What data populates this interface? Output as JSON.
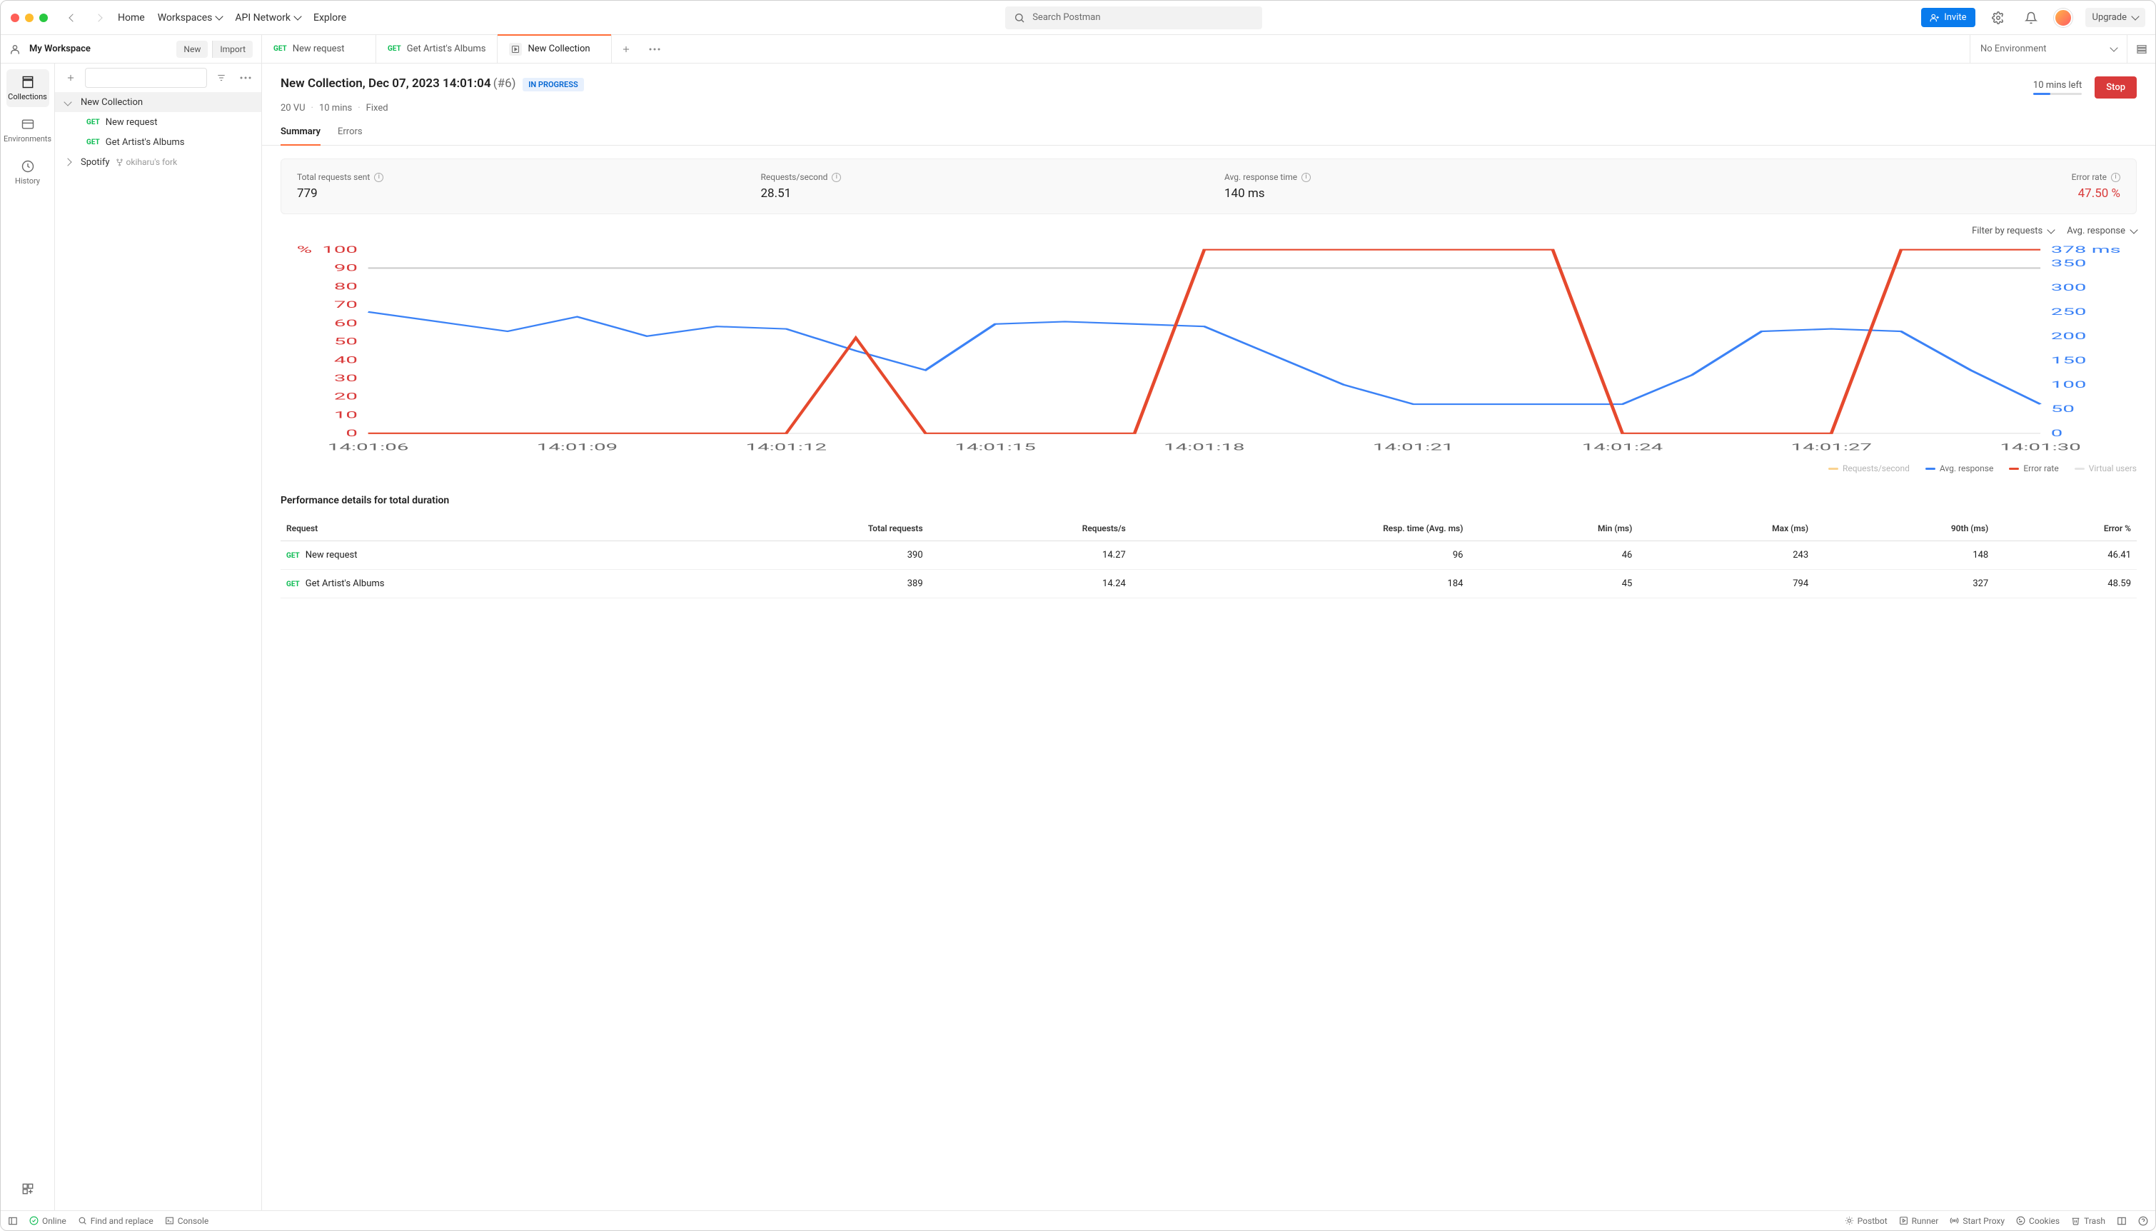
{
  "topbar": {
    "home": "Home",
    "workspaces": "Workspaces",
    "api_network": "API Network",
    "explore": "Explore",
    "search_placeholder": "Search Postman",
    "invite": "Invite",
    "upgrade": "Upgrade"
  },
  "workspace": {
    "name": "My Workspace",
    "new_btn": "New",
    "import_btn": "Import"
  },
  "tabs": [
    {
      "method": "GET",
      "label": "New request",
      "active": false,
      "kind": "request"
    },
    {
      "method": "GET",
      "label": "Get Artist's Albums",
      "active": false,
      "kind": "request"
    },
    {
      "method": "",
      "label": "New Collection",
      "active": true,
      "kind": "runner"
    }
  ],
  "env": {
    "selected": "No Environment"
  },
  "rail": {
    "collections": "Collections",
    "environments": "Environments",
    "history": "History"
  },
  "sidebar": {
    "tree": [
      {
        "label": "New Collection",
        "level": 1,
        "expanded": true,
        "selected": true
      },
      {
        "label": "New request",
        "level": 2,
        "method": "GET"
      },
      {
        "label": "Get Artist's Albums",
        "level": 2,
        "method": "GET"
      },
      {
        "label": "Spotify",
        "level": 1,
        "expanded": false,
        "fork": "okiharu's fork"
      }
    ]
  },
  "run": {
    "title": "New Collection, Dec 07, 2023 14:01:04",
    "id": "(#6)",
    "status": "IN PROGRESS",
    "time_left": "10 mins left",
    "stop": "Stop",
    "meta": {
      "vu": "20 VU",
      "duration": "10 mins",
      "profile": "Fixed"
    }
  },
  "subtabs": {
    "summary": "Summary",
    "errors": "Errors"
  },
  "stats": {
    "total_label": "Total requests sent",
    "total_val": "779",
    "rps_label": "Requests/second",
    "rps_val": "28.51",
    "resp_label": "Avg. response time",
    "resp_val": "140 ms",
    "err_label": "Error rate",
    "err_val": "47.50 %"
  },
  "filters": {
    "by_requests": "Filter by requests",
    "metric": "Avg. response"
  },
  "legend": {
    "rps": "Requests/second",
    "resp": "Avg. response",
    "err": "Error rate",
    "vu": "Virtual users"
  },
  "perf": {
    "header": "Performance details for total duration",
    "cols": [
      "Request",
      "Total requests",
      "Requests/s",
      "Resp. time (Avg. ms)",
      "Min (ms)",
      "Max (ms)",
      "90th (ms)",
      "Error %"
    ],
    "rows": [
      {
        "method": "GET",
        "name": "New request",
        "total": "390",
        "rps": "14.27",
        "avg": "96",
        "min": "46",
        "max": "243",
        "p90": "148",
        "err": "46.41"
      },
      {
        "method": "GET",
        "name": "Get Artist's Albums",
        "total": "389",
        "rps": "14.24",
        "avg": "184",
        "min": "45",
        "max": "794",
        "p90": "327",
        "err": "48.59"
      }
    ]
  },
  "statusbar": {
    "online": "Online",
    "find": "Find and replace",
    "console": "Console",
    "postbot": "Postbot",
    "runner": "Runner",
    "proxy": "Start Proxy",
    "cookies": "Cookies",
    "trash": "Trash"
  },
  "chart_data": {
    "type": "line",
    "x": [
      "14:01:06",
      "14:01:07",
      "14:01:08",
      "14:01:09",
      "14:01:10",
      "14:01:11",
      "14:01:12",
      "14:01:13",
      "14:01:14",
      "14:01:15",
      "14:01:16",
      "14:01:17",
      "14:01:18",
      "14:01:19",
      "14:01:20",
      "14:01:21",
      "14:01:22",
      "14:01:23",
      "14:01:24",
      "14:01:25",
      "14:01:26",
      "14:01:27",
      "14:01:28",
      "14:01:29",
      "14:01:30"
    ],
    "x_ticks": [
      "14:01:06",
      "14:01:09",
      "14:01:12",
      "14:01:15",
      "14:01:18",
      "14:01:21",
      "14:01:24",
      "14:01:27",
      "14:01:30"
    ],
    "left_axis": {
      "label": "%",
      "min": 0,
      "max": 100,
      "ticks": [
        0,
        10,
        20,
        30,
        40,
        50,
        60,
        70,
        80,
        90,
        100
      ]
    },
    "right_axis": {
      "label": "ms",
      "min": 0,
      "max": 378,
      "ticks": [
        0,
        50,
        100,
        150,
        200,
        250,
        300,
        350,
        "378 ms"
      ]
    },
    "series": [
      {
        "name": "Error rate",
        "axis": "left",
        "color": "#e6492d",
        "values": [
          0,
          0,
          0,
          0,
          0,
          0,
          0,
          52,
          0,
          0,
          0,
          0,
          100,
          100,
          100,
          100,
          100,
          100,
          0,
          0,
          0,
          0,
          100,
          100,
          100
        ]
      },
      {
        "name": "Avg. response",
        "axis": "right",
        "color": "#3b82f6",
        "values": [
          250,
          230,
          210,
          240,
          200,
          220,
          215,
          170,
          130,
          225,
          230,
          225,
          220,
          160,
          100,
          60,
          60,
          60,
          60,
          120,
          210,
          215,
          210,
          130,
          60
        ]
      },
      {
        "name": "Virtual users",
        "axis": "left",
        "color": "#cccccc",
        "values": [
          90,
          90,
          90,
          90,
          90,
          90,
          90,
          90,
          90,
          90,
          90,
          90,
          90,
          90,
          90,
          90,
          90,
          90,
          90,
          90,
          90,
          90,
          90,
          90,
          90
        ]
      }
    ],
    "legend": [
      "Requests/second",
      "Avg. response",
      "Error rate",
      "Virtual users"
    ]
  }
}
